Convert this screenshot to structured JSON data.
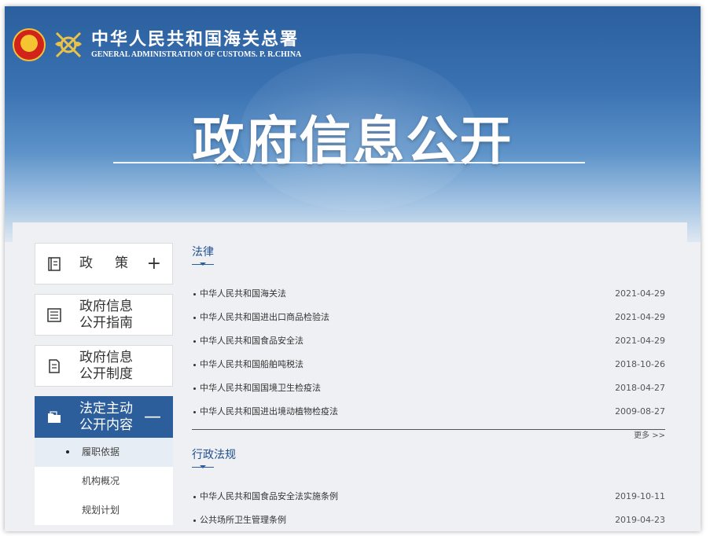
{
  "header": {
    "org_cn": "中华人民共和国海关总署",
    "org_en": "GENERAL ADMINISTRATION OF CUSTOMS. P. R.CHINA",
    "banner_title": "政府信息公开"
  },
  "sidebar": {
    "items": [
      {
        "label": "政策",
        "sign": "+"
      },
      {
        "label_line1": "政府信息",
        "label_line2": "公开指南"
      },
      {
        "label_line1": "政府信息",
        "label_line2": "公开制度"
      },
      {
        "label_line1": "法定主动",
        "label_line2": "公开内容",
        "sign": "—"
      }
    ],
    "sub_items": [
      "履职依据",
      "机构概况",
      "规划计划"
    ]
  },
  "sections": [
    {
      "title": "法律",
      "rows": [
        {
          "name": "中华人民共和国海关法",
          "date": "2021-04-29"
        },
        {
          "name": "中华人民共和国进出口商品检验法",
          "date": "2021-04-29"
        },
        {
          "name": "中华人民共和国食品安全法",
          "date": "2021-04-29"
        },
        {
          "name": "中华人民共和国船舶吨税法",
          "date": "2018-10-26"
        },
        {
          "name": "中华人民共和国国境卫生检疫法",
          "date": "2018-04-27"
        },
        {
          "name": "中华人民共和国进出境动植物检疫法",
          "date": "2009-08-27"
        }
      ],
      "more": "更多 >>"
    },
    {
      "title": "行政法规",
      "rows": [
        {
          "name": "中华人民共和国食品安全法实施条例",
          "date": "2019-10-11"
        },
        {
          "name": "公共场所卫生管理条例",
          "date": "2019-04-23"
        }
      ]
    }
  ],
  "colors": {
    "primary": "#2d5e9c",
    "banner_top": "#2b5f9e",
    "emblem_red": "#d2231b"
  },
  "icons": [
    "national-emblem-icon",
    "customs-emblem-icon",
    "book-icon",
    "list-icon",
    "document-icon",
    "folder-icon"
  ]
}
